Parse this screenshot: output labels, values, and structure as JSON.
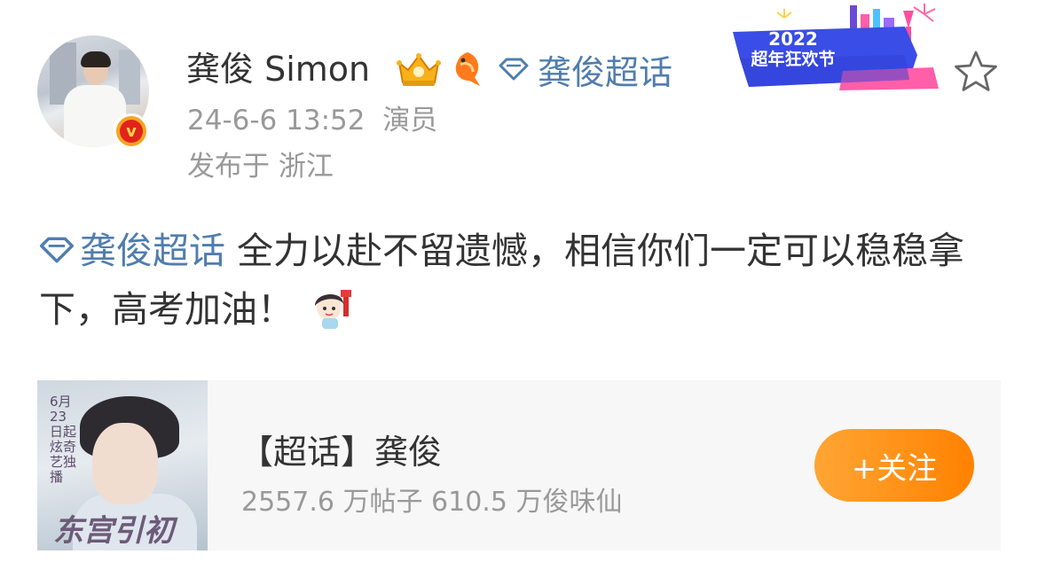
{
  "post": {
    "author": "龚俊 Simon",
    "header_topic": "龚俊超话",
    "event_badge": {
      "year": "2022",
      "name": "超年狂欢节"
    },
    "timestamp": "24-6-6 13:52",
    "role": "演员",
    "location": "发布于 浙江",
    "body": {
      "topic": "龚俊超话",
      "text": " 全力以赴不留遗憾，相信你们一定可以稳稳拿下，高考加油！"
    },
    "icons": {
      "verified": "verified-badge-icon",
      "crown": "crown-icon",
      "fish": "koi-fish-icon",
      "topic": "topic-diamond-icon",
      "star": "star-icon",
      "emoji": "cheer-emoji-icon"
    }
  },
  "card": {
    "cover": {
      "vertical_text": "6月23日起炫奇艺独播",
      "title_art": "东宫引初"
    },
    "title": "【超话】龚俊",
    "stats": "2557.6 万帖子 610.5 万俊味仙",
    "follow_label": "+关注"
  },
  "colors": {
    "link": "#507daf",
    "follow_start": "#ffa534",
    "follow_end": "#ff8200",
    "badge": "#f5a623"
  }
}
